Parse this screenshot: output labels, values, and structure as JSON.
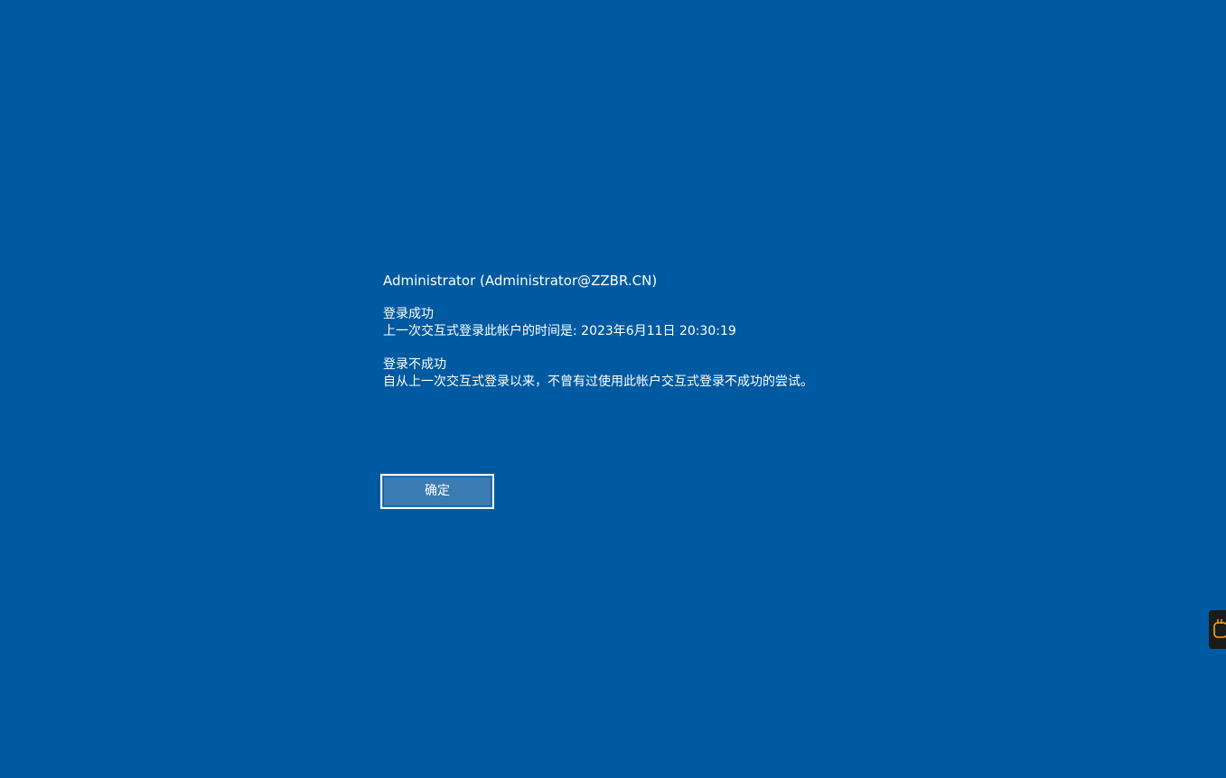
{
  "account": {
    "label": "Administrator (Administrator@ZZBR.CN)"
  },
  "login_success": {
    "title": "登录成功",
    "text": "上一次交互式登录此帐户的时间是: 2023年6月11日 20:30:19"
  },
  "login_failure": {
    "title": "登录不成功",
    "text": "自从上一次交互式登录以来，不曾有过使用此帐户交互式登录不成功的尝试。"
  },
  "buttons": {
    "ok_label": "确定"
  },
  "side_tab": {
    "icon": "bag-icon",
    "icon_color": "#f5a623"
  },
  "colors": {
    "background": "#005aa1",
    "button_fill": "#3a7bb4"
  }
}
